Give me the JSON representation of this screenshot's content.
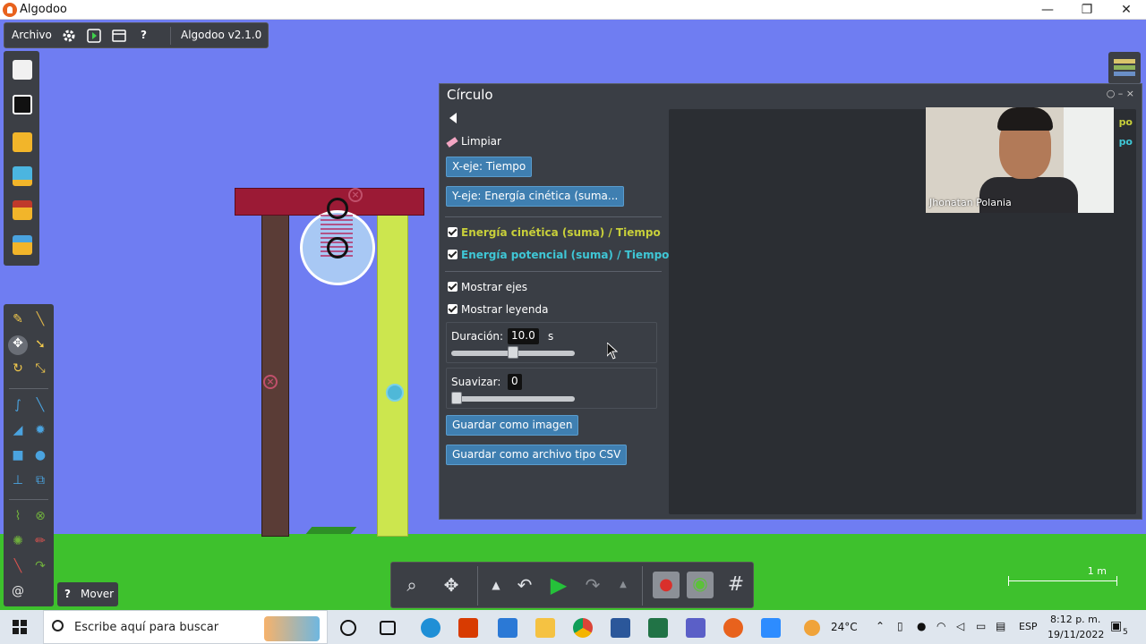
{
  "window": {
    "title": "Algodoo",
    "min": "—",
    "restore": "❐",
    "close": "✕"
  },
  "menu": {
    "archivo": "Archivo",
    "version": "Algodoo v2.1.0",
    "help": "?"
  },
  "help_bubble": {
    "q": "?",
    "label": "Mover"
  },
  "plot": {
    "title": "Círculo",
    "window_ctrls": "○  –  ×",
    "clear": "Limpiar",
    "x_axis_button": "X-eje: Tiempo",
    "y_axis_button": "Y-eje: Energía cinética (suma...",
    "series": [
      {
        "label": "Energía cinética (suma) / Tiempo",
        "color": "#c8cf3a"
      },
      {
        "label": "Energía potencial (suma) / Tiempo",
        "color": "#3fc7d6"
      }
    ],
    "show_axes": "Mostrar ejes",
    "show_legend": "Mostrar leyenda",
    "duration_label": "Duración:",
    "duration_value": "10.0",
    "duration_unit": "s",
    "duration_fraction": 0.5,
    "smooth_label": "Suavizar:",
    "smooth_value": "0",
    "smooth_fraction": 0,
    "save_image": "Guardar como imagen",
    "save_csv": "Guardar como archivo tipo CSV",
    "legend_frag_1": "po",
    "legend_frag_2": "po"
  },
  "webcam": {
    "name": "Jhonatan Polania"
  },
  "scale": {
    "label": "1 m"
  },
  "taskbar": {
    "search_placeholder": "Escribe aquí para buscar",
    "weather": "24°C",
    "lang": "ESP",
    "time": "8:12 p. m.",
    "date": "19/11/2022",
    "notif_count": "5"
  },
  "colors": {
    "sky": "#6f7df2",
    "ground": "#3ec12d",
    "beam": "#9b1a35",
    "left_post": "#5a3c36",
    "right_post": "#cce64e",
    "ball": "#a8c8f4",
    "button": "#3f7fb1"
  }
}
